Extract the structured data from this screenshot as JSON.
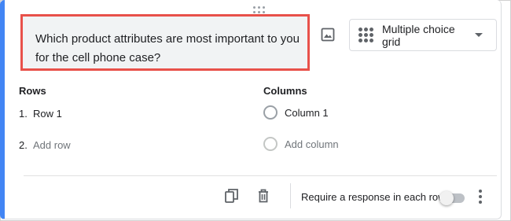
{
  "question": {
    "text": "Which product attributes are most important to you for the cell phone case?"
  },
  "question_type": {
    "label": "Multiple choice grid",
    "icon": "grid-dots-icon"
  },
  "rows": {
    "title": "Rows",
    "items": [
      {
        "num": "1.",
        "label": "Row 1"
      }
    ],
    "add": {
      "num": "2.",
      "label": "Add row"
    }
  },
  "columns": {
    "title": "Columns",
    "items": [
      {
        "label": "Column 1"
      }
    ],
    "add": {
      "label": "Add column"
    }
  },
  "footer": {
    "require_label": "Require a response in each row",
    "require_enabled": false,
    "icons": [
      "duplicate-icon",
      "delete-icon",
      "more-vert-icon"
    ]
  },
  "colors": {
    "accent": "#4285f4",
    "highlight_border": "#e8514a"
  }
}
